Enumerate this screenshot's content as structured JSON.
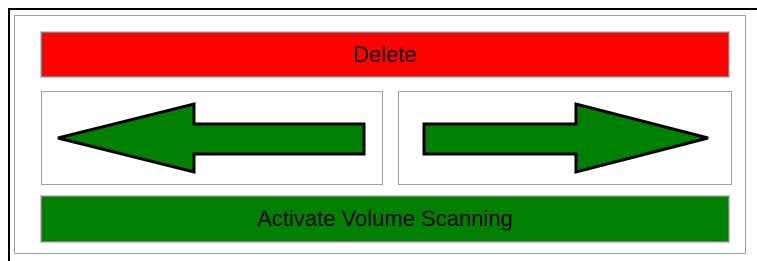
{
  "controls": {
    "delete_label": "Delete",
    "activate_label": "Activate Volume Scanning",
    "left_arrow_icon": "arrow-left-icon",
    "right_arrow_icon": "arrow-right-icon"
  },
  "colors": {
    "delete_bg": "#ff0000",
    "activate_bg": "#008000",
    "arrow_fill": "#008000",
    "arrow_stroke": "#000000"
  }
}
